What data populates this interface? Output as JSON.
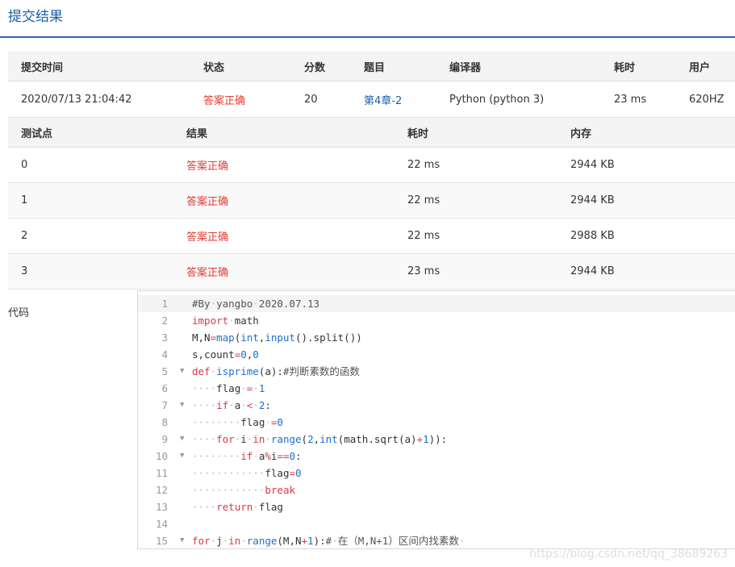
{
  "page_title": "提交结果",
  "summary": {
    "headers": [
      "提交时间",
      "状态",
      "分数",
      "题目",
      "编译器",
      "耗时",
      "用户"
    ],
    "row": {
      "time": "2020/07/13 21:04:42",
      "status": "答案正确",
      "score": "20",
      "problem": "第4章-2",
      "compiler": "Python (python 3)",
      "elapsed": "23 ms",
      "user": "620HZ"
    }
  },
  "tests": {
    "headers": [
      "测试点",
      "结果",
      "耗时",
      "内存"
    ],
    "rows": [
      {
        "id": "0",
        "result": "答案正确",
        "time": "22 ms",
        "memory": "2944 KB"
      },
      {
        "id": "1",
        "result": "答案正确",
        "time": "22 ms",
        "memory": "2944 KB"
      },
      {
        "id": "2",
        "result": "答案正确",
        "time": "22 ms",
        "memory": "2988 KB"
      },
      {
        "id": "3",
        "result": "答案正确",
        "time": "23 ms",
        "memory": "2944 KB"
      }
    ]
  },
  "code": {
    "label": "代码",
    "lines": [
      {
        "n": "1",
        "text": "#By·yangbo·2020.07.13",
        "fold": false
      },
      {
        "n": "2",
        "text": "import·math",
        "fold": false
      },
      {
        "n": "3",
        "text": "M,N=map(int,input().split())",
        "fold": false
      },
      {
        "n": "4",
        "text": "s,count=0,0",
        "fold": false
      },
      {
        "n": "5",
        "text": "def·isprime(a):#判断素数的函数",
        "fold": true
      },
      {
        "n": "6",
        "text": "····flag·=·1",
        "fold": false
      },
      {
        "n": "7",
        "text": "····if·a·<·2:",
        "fold": true
      },
      {
        "n": "8",
        "text": "········flag·=0",
        "fold": false
      },
      {
        "n": "9",
        "text": "····for·i·in·range(2,int(math.sqrt(a)+1)):",
        "fold": true
      },
      {
        "n": "10",
        "text": "········if·a%i==0:",
        "fold": true
      },
      {
        "n": "11",
        "text": "············flag=0",
        "fold": false
      },
      {
        "n": "12",
        "text": "············break",
        "fold": false
      },
      {
        "n": "13",
        "text": "····return·flag",
        "fold": false
      },
      {
        "n": "14",
        "text": "",
        "fold": false
      },
      {
        "n": "15",
        "text": "for·j·in·range(M,N+1):#·在（M,N+1）区间内找素数·",
        "fold": true
      }
    ]
  },
  "watermark": "https://blog.csdn.net/qq_38689263"
}
